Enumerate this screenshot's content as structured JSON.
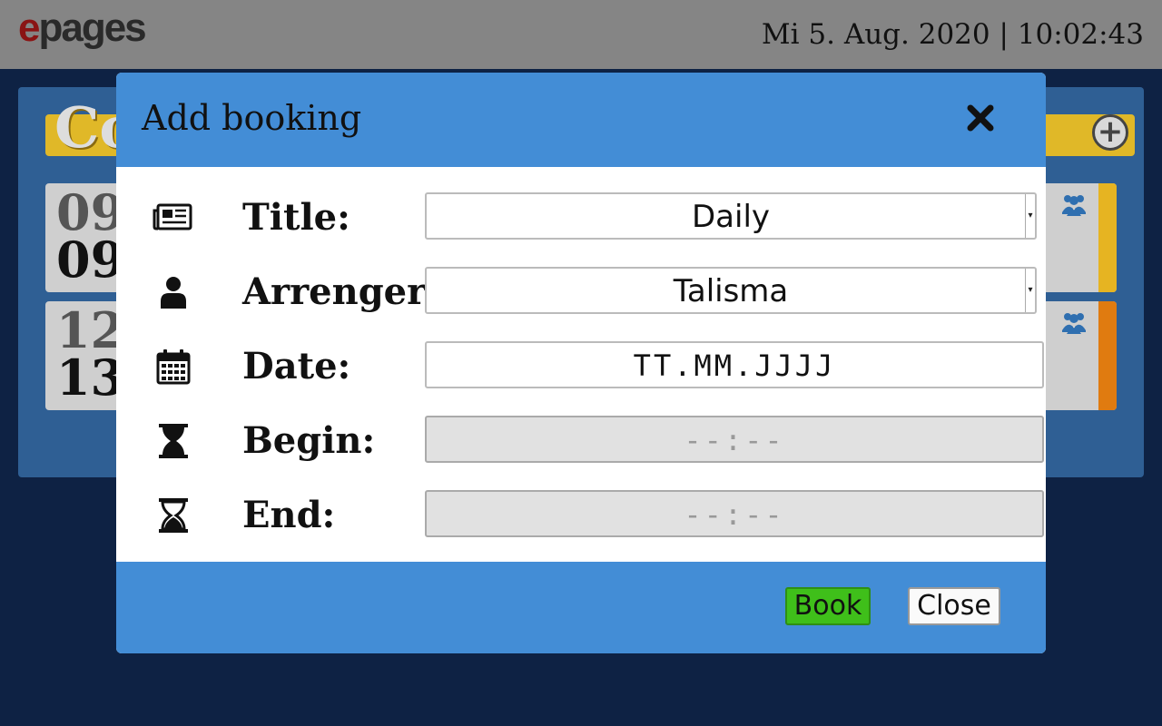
{
  "header": {
    "logo_e": "e",
    "logo_rest": "pages",
    "datetime": "Mi 5. Aug. 2020 | 10:02:43"
  },
  "background": {
    "title_partial": "Co",
    "cards": [
      {
        "time_start": "09",
        "time_end": "09",
        "stripe_color": "#e6b422"
      },
      {
        "time_start": "12",
        "time_end": "13",
        "stripe_color": "#e07b10"
      }
    ]
  },
  "modal": {
    "title": "Add booking",
    "fields": {
      "title": {
        "label": "Title:",
        "value": "Daily",
        "icon": "newspaper-icon"
      },
      "arranger": {
        "label": "Arrenger:",
        "value": "Talisma",
        "icon": "user-icon"
      },
      "date": {
        "label": "Date:",
        "placeholder": "TT.MM.JJJJ",
        "icon": "calendar-icon"
      },
      "begin": {
        "label": "Begin:",
        "placeholder": "--:--",
        "icon": "hourglass-start-icon"
      },
      "end": {
        "label": "End:",
        "placeholder": "--:--",
        "icon": "hourglass-end-icon"
      }
    },
    "buttons": {
      "book": "Book",
      "close": "Close"
    }
  },
  "colors": {
    "modal_accent": "#438dd6",
    "book_button": "#3fbf1a",
    "page_background": "#0e2244",
    "topbar": "#858585"
  }
}
